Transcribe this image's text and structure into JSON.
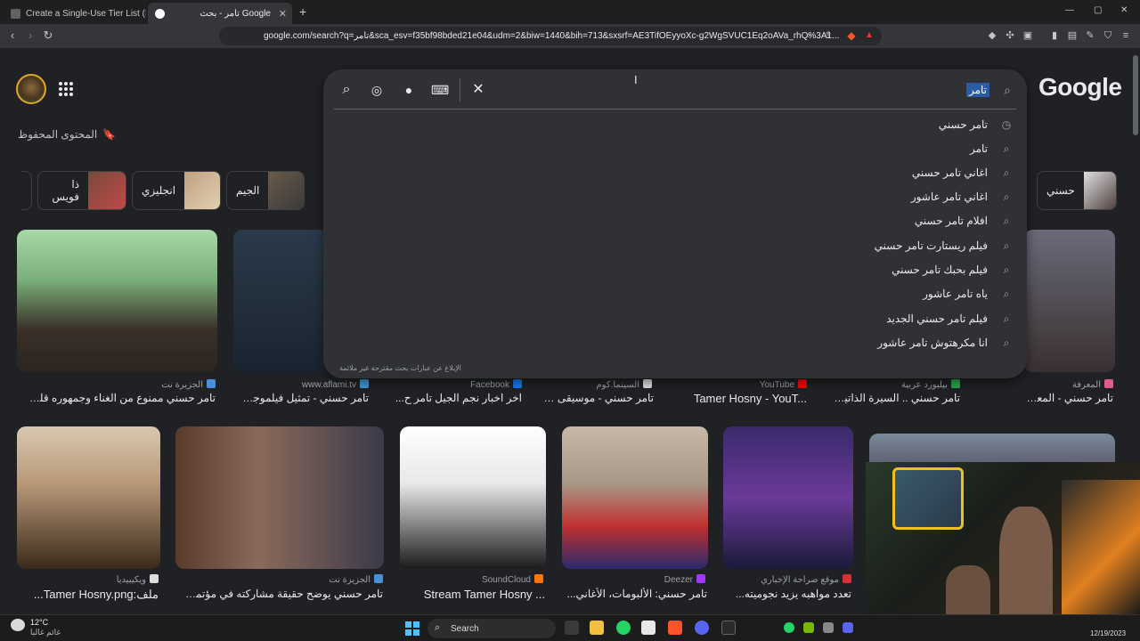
{
  "tabs": [
    {
      "title": "Create a Single-Use Tier List (Private",
      "active": false
    },
    {
      "title": "تامر - بحث Google",
      "active": true
    }
  ],
  "new_tab_label": "+",
  "window_controls": [
    "—",
    "▢",
    "✕"
  ],
  "address_bar": {
    "url": "google.com/search?q=تامر&sca_esv=f35bf98bded21e04&udm=2&biw=1440&bih=713&sxsrf=AE3TifOEyyoXc-g2WgSVUC1Eq2oAVa_rhQ%3A1..."
  },
  "header": {
    "logo": "Google",
    "saved_label": "المحتوى المحفوظ"
  },
  "search": {
    "query": "تامر",
    "suggestions": [
      {
        "text": "تامر حسني",
        "icon": "history-icon"
      },
      {
        "text": "تامر",
        "icon": "search-icon"
      },
      {
        "text": "اغاني تامر حسني",
        "icon": "search-icon"
      },
      {
        "text": "اغاني تامر عاشور",
        "icon": "search-icon"
      },
      {
        "text": "افلام تامر حسني",
        "icon": "search-icon"
      },
      {
        "text": "فيلم ريستارت تامر حسني",
        "icon": "search-icon"
      },
      {
        "text": "فيلم بحبك تامر حسني",
        "icon": "search-icon"
      },
      {
        "text": "ياه تامر عاشور",
        "icon": "search-icon"
      },
      {
        "text": "فيلم تامر حسني الجديد",
        "icon": "search-icon"
      },
      {
        "text": "انا مكرهتوش تامر عاشور",
        "icon": "search-icon"
      }
    ],
    "report_text": "الإبلاغ عن عبارات بحث مقترحة غير ملائمة"
  },
  "chips": [
    "ذا فويس",
    "انجليزي",
    "الجيم",
    "حسني"
  ],
  "results_row1": [
    {
      "source": "الجزيرة نت",
      "title": "تامر حسني ممنوع من الغناء وجمهوره قلق |...",
      "color": "#4a90d9"
    },
    {
      "source": "www.aflami.tv",
      "title": "تامر حسني - تمثيل فيلموجرا...",
      "color": "#3a9ad9"
    },
    {
      "source": "Facebook",
      "title": "اخر اخبار نجم الجيل تامر ح...",
      "color": "#1877f2"
    },
    {
      "source": "السينما.كوم",
      "title": "تامر حسني - موسيقى ف...",
      "color": "#dddddd"
    },
    {
      "source": "YouTube",
      "title": "Tamer Hosny - YouT...",
      "color": "#ff0000"
    },
    {
      "source": "بيلبورد عربية",
      "title": "تامر حسني .. السيرة الذاتية ...",
      "color": "#2ea44f"
    },
    {
      "source": "المعرفة",
      "title": "تامر حسني - المعرفة",
      "color": "#e05a8a"
    }
  ],
  "results_row2": [
    {
      "source": "ويكيبيديا",
      "title": "ملف:Tamer Hosny.png...",
      "color": "#dddddd"
    },
    {
      "source": "الجزيرة نت",
      "title": "تامر حسني يوضح حقيقة مشاركته في مؤتمر ...",
      "color": "#4a90d9"
    },
    {
      "source": "SoundCloud",
      "title": "Stream Tamer Hosny ...",
      "color": "#ff7700"
    },
    {
      "source": "Deezer",
      "title": "تامر حسني: الألبومات، الأغاني...",
      "color": "#a238ff"
    },
    {
      "source": "موقع صراحة الإخباري",
      "title": "تعدد مواهبه يزيد نجوميته...",
      "color": "#d93030"
    }
  ],
  "taskbar": {
    "weather_temp": "12°C",
    "weather_desc": "غائم غالبا",
    "search_label": "Search",
    "date": "12/19/2023"
  }
}
